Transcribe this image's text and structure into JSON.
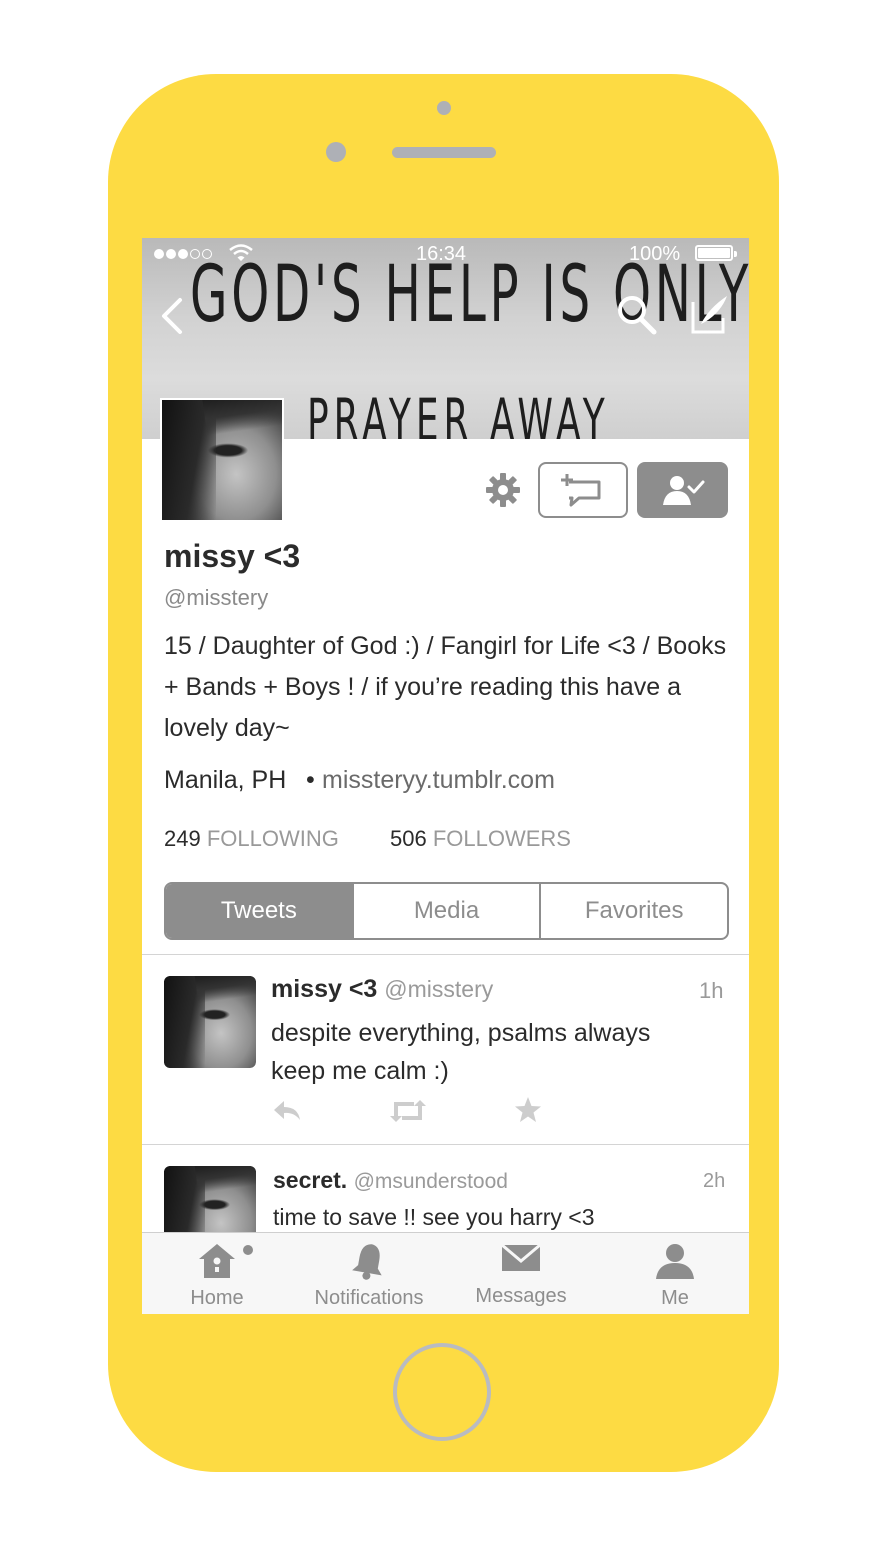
{
  "status_bar": {
    "time": "16:34",
    "battery": "100%"
  },
  "banner": {
    "line1": "GOD'S HELP IS ONLY",
    "line2": "PRAYER AWAY"
  },
  "profile": {
    "name": "missy <3",
    "handle": "@misstery",
    "bio": "15 / Daughter of God :) / Fangirl for Life <3 / Books + Bands + Boys ! / if you’re reading this have a lovely day~",
    "location": "Manila, PH",
    "separator": "•",
    "url": "missteryy.tumblr.com",
    "following_count": "249",
    "following_label": "FOLLOWING",
    "followers_count": "506",
    "followers_label": "FOLLOWERS"
  },
  "tabs": {
    "tweets": "Tweets",
    "media": "Media",
    "favorites": "Favorites"
  },
  "tweets": [
    {
      "name": "missy <3",
      "handle": "@misstery",
      "time": "1h",
      "line1": "despite everything, psalms always",
      "line2": "keep me calm :)"
    },
    {
      "name": "secret.",
      "handle": "@msunderstood",
      "time": "2h",
      "line1": "time to save !! see you harry <3"
    }
  ],
  "tabbar": {
    "home": "Home",
    "notifications": "Notifications",
    "messages": "Messages",
    "me": "Me"
  },
  "colors": {
    "shell": "#fddb43",
    "accent_gray": "#8d8d8d",
    "button_gray": "#aeb0b6"
  }
}
